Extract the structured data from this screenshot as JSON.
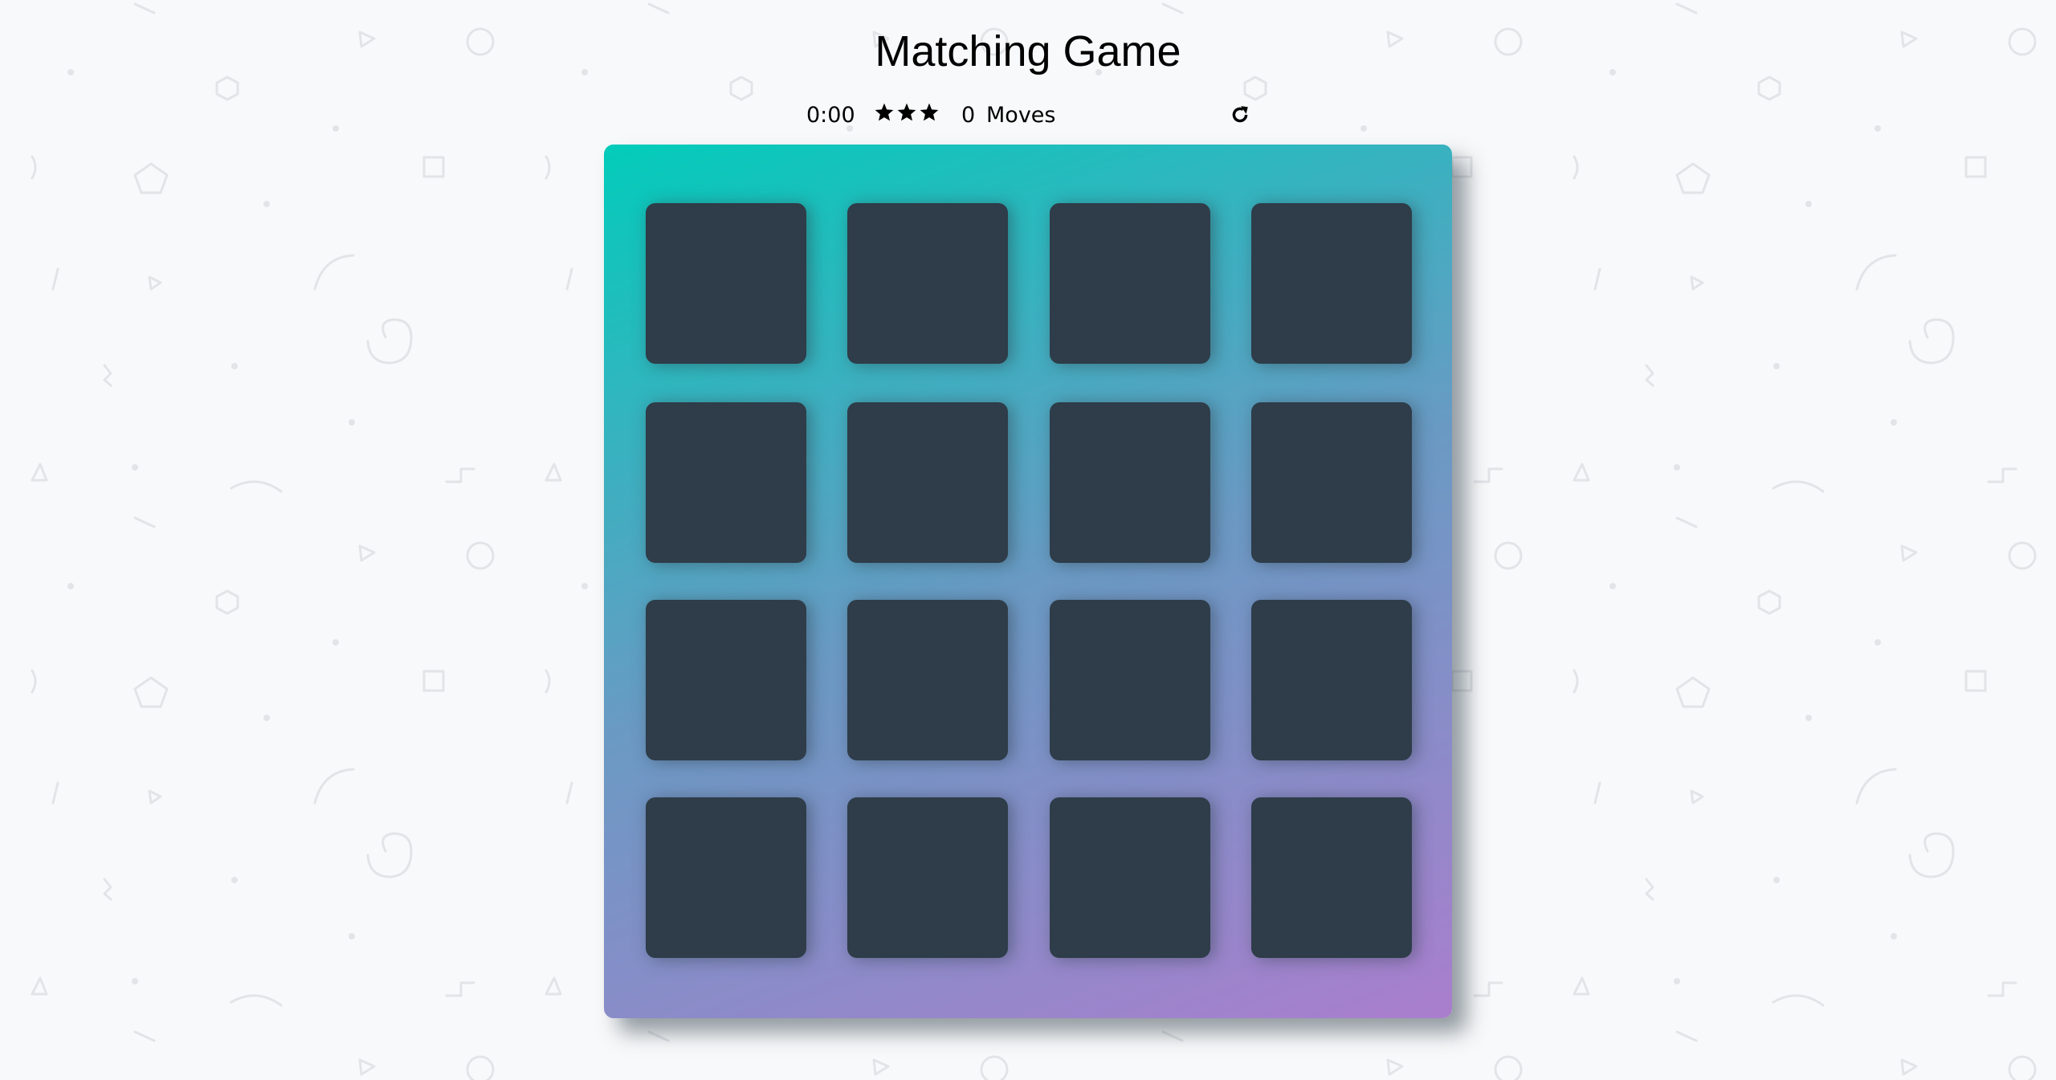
{
  "title": "Matching Game",
  "score_panel": {
    "timer": "0:00",
    "stars": [
      "star-icon",
      "star-icon",
      "star-icon"
    ],
    "moves_count": "0",
    "moves_label": "Moves",
    "restart_icon": "repeat-icon"
  },
  "deck": {
    "rows": 4,
    "columns": 4,
    "cards": [
      {
        "state": "face-down"
      },
      {
        "state": "face-down"
      },
      {
        "state": "face-down"
      },
      {
        "state": "face-down"
      },
      {
        "state": "face-down"
      },
      {
        "state": "face-down"
      },
      {
        "state": "face-down"
      },
      {
        "state": "face-down"
      },
      {
        "state": "face-down"
      },
      {
        "state": "face-down"
      },
      {
        "state": "face-down"
      },
      {
        "state": "face-down"
      },
      {
        "state": "face-down"
      },
      {
        "state": "face-down"
      },
      {
        "state": "face-down"
      },
      {
        "state": "face-down"
      }
    ]
  },
  "colors": {
    "background": "#f8f9fa",
    "card_back": "#2e3d49",
    "deck_gradient_start": "#02ccba",
    "deck_gradient_end": "#aa7ecd"
  }
}
